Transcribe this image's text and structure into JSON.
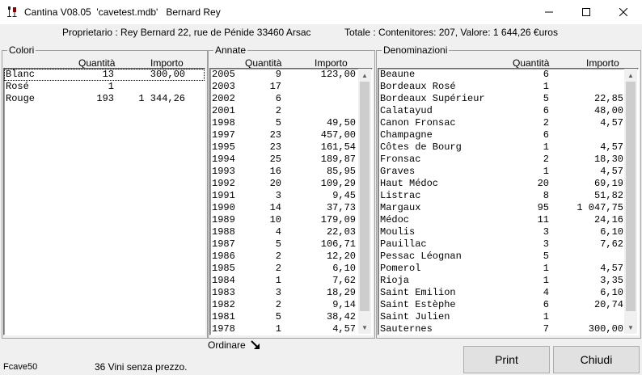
{
  "window": {
    "title": "Cantina V08.05  'cavetest.mdb'   Bernard Rey"
  },
  "info": {
    "owner": "Proprietario : Rey Bernard 22, rue de Pénide 33460 Arsac",
    "totals": "Totale : Contenitores: 207, Valore: 1 644,26 €uros"
  },
  "colori": {
    "label": "Colori",
    "col_qty": "Quantità",
    "col_amount": "Importo",
    "rows": [
      {
        "name": "Blanc",
        "qty": "13",
        "amount": "300,00"
      },
      {
        "name": "Rosé",
        "qty": "1",
        "amount": ""
      },
      {
        "name": "Rouge",
        "qty": "193",
        "amount": "1 344,26"
      }
    ]
  },
  "annate": {
    "label": "Annate",
    "col_qty": "Quantità",
    "col_amount": "Importo",
    "rows": [
      {
        "name": "2005",
        "qty": "9",
        "amount": "123,00"
      },
      {
        "name": "2003",
        "qty": "17",
        "amount": ""
      },
      {
        "name": "2002",
        "qty": "6",
        "amount": ""
      },
      {
        "name": "2001",
        "qty": "2",
        "amount": ""
      },
      {
        "name": "1998",
        "qty": "5",
        "amount": "49,50"
      },
      {
        "name": "1997",
        "qty": "23",
        "amount": "457,00"
      },
      {
        "name": "1995",
        "qty": "23",
        "amount": "161,54"
      },
      {
        "name": "1994",
        "qty": "25",
        "amount": "189,87"
      },
      {
        "name": "1993",
        "qty": "16",
        "amount": "85,95"
      },
      {
        "name": "1992",
        "qty": "20",
        "amount": "109,29"
      },
      {
        "name": "1991",
        "qty": "3",
        "amount": "9,45"
      },
      {
        "name": "1990",
        "qty": "14",
        "amount": "37,73"
      },
      {
        "name": "1989",
        "qty": "10",
        "amount": "179,09"
      },
      {
        "name": "1988",
        "qty": "4",
        "amount": "22,03"
      },
      {
        "name": "1987",
        "qty": "5",
        "amount": "106,71"
      },
      {
        "name": "1986",
        "qty": "2",
        "amount": "12,20"
      },
      {
        "name": "1985",
        "qty": "2",
        "amount": "6,10"
      },
      {
        "name": "1984",
        "qty": "1",
        "amount": "7,62"
      },
      {
        "name": "1983",
        "qty": "3",
        "amount": "18,29"
      },
      {
        "name": "1982",
        "qty": "2",
        "amount": "9,14"
      },
      {
        "name": "1981",
        "qty": "5",
        "amount": "38,42"
      },
      {
        "name": "1978",
        "qty": "1",
        "amount": "4,57"
      }
    ]
  },
  "denominazioni": {
    "label": "Denominazioni",
    "col_qty": "Quantità",
    "col_amount": "Importo",
    "rows": [
      {
        "name": "Beaune",
        "qty": "6",
        "amount": ""
      },
      {
        "name": "Bordeaux Rosé",
        "qty": "1",
        "amount": ""
      },
      {
        "name": "Bordeaux Supérieur",
        "qty": "5",
        "amount": "22,85"
      },
      {
        "name": "Calatayud",
        "qty": "6",
        "amount": "48,00"
      },
      {
        "name": "Canon Fronsac",
        "qty": "2",
        "amount": "4,57"
      },
      {
        "name": "Champagne",
        "qty": "6",
        "amount": ""
      },
      {
        "name": "Côtes de Bourg",
        "qty": "1",
        "amount": "4,57"
      },
      {
        "name": "Fronsac",
        "qty": "2",
        "amount": "18,30"
      },
      {
        "name": "Graves",
        "qty": "1",
        "amount": "4,57"
      },
      {
        "name": "Haut Médoc",
        "qty": "20",
        "amount": "69,19"
      },
      {
        "name": "Listrac",
        "qty": "8",
        "amount": "51,82"
      },
      {
        "name": "Margaux",
        "qty": "95",
        "amount": "1 047,75"
      },
      {
        "name": "Médoc",
        "qty": "11",
        "amount": "24,16"
      },
      {
        "name": "Moulis",
        "qty": "3",
        "amount": "6,10"
      },
      {
        "name": "Pauillac",
        "qty": "3",
        "amount": "7,62"
      },
      {
        "name": "Pessac Léognan",
        "qty": "5",
        "amount": ""
      },
      {
        "name": "Pomerol",
        "qty": "1",
        "amount": "4,57"
      },
      {
        "name": "Rioja",
        "qty": "1",
        "amount": "3,35"
      },
      {
        "name": "Saint Emilion",
        "qty": "4",
        "amount": "6,10"
      },
      {
        "name": "Saint Estèphe",
        "qty": "6",
        "amount": "20,74"
      },
      {
        "name": "Saint Julien",
        "qty": "1",
        "amount": ""
      },
      {
        "name": "Sauternes",
        "qty": "7",
        "amount": "300,00"
      }
    ]
  },
  "ordinare": {
    "label": "Ordinare"
  },
  "buttons": {
    "print": "Print",
    "close": "Chiudi"
  },
  "status": {
    "form_id": "Fcave50",
    "message": "36 Vini senza prezzo."
  }
}
